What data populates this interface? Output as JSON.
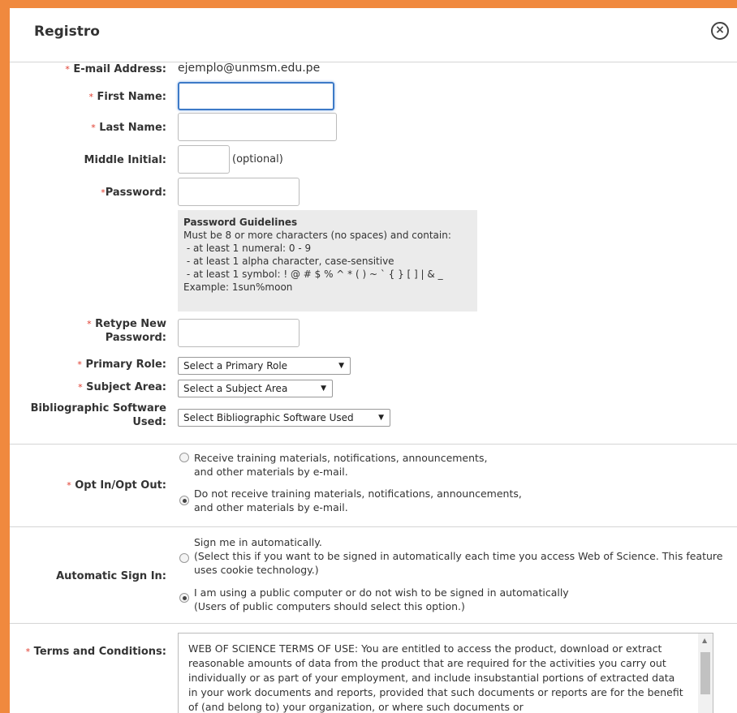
{
  "dialog": {
    "title": "Registro"
  },
  "form": {
    "email": {
      "label": "E-mail Address:",
      "value": "ejemplo@unmsm.edu.pe"
    },
    "first_name": {
      "label": "First Name:",
      "value": ""
    },
    "last_name": {
      "label": "Last Name:",
      "value": ""
    },
    "middle_initial": {
      "label": "Middle Initial:",
      "value": "",
      "hint": "(optional)"
    },
    "password": {
      "label": "Password:",
      "value": ""
    },
    "guidelines": {
      "title": "Password Guidelines",
      "lines": [
        "Must be 8 or more characters (no spaces) and contain:",
        " - at least 1 numeral: 0 - 9",
        " - at least 1 alpha character, case-sensitive",
        " - at least 1 symbol: ! @ # $ % ^ * ( ) ~ ` { } [ ] | & _",
        "Example: 1sun%moon"
      ]
    },
    "retype": {
      "label_line1": "Retype New",
      "label_line2": "Password:",
      "value": ""
    },
    "primary_role": {
      "label": "Primary Role:",
      "selected": "Select a Primary Role"
    },
    "subject_area": {
      "label": "Subject Area:",
      "selected": "Select a Subject Area"
    },
    "biblio": {
      "label_line1": "Bibliographic Software",
      "label_line2": "Used:",
      "selected": "Select Bibliographic Software Used"
    }
  },
  "opt": {
    "label": "Opt In/Opt Out:",
    "options": [
      {
        "line1": "Receive training materials, notifications, announcements,",
        "line2": "and other materials by e-mail.",
        "selected": false
      },
      {
        "line1": "Do not receive training materials, notifications, announcements,",
        "line2": "and other materials by e-mail.",
        "selected": true
      }
    ]
  },
  "signin": {
    "label": "Automatic Sign In:",
    "options": [
      {
        "line1": "Sign me in automatically.",
        "line2": "(Select this if you want to be signed in automatically each time you access Web of Science. This feature",
        "line3": "uses cookie technology.)",
        "selected": false
      },
      {
        "line1": "I am using a public computer or do not wish to be signed in automatically",
        "line2": "(Users of public computers should select this option.)",
        "selected": true
      }
    ]
  },
  "terms": {
    "label": "Terms and Conditions:",
    "text": "WEB OF SCIENCE TERMS OF USE: You are entitled to access the product, download or extract reasonable amounts of data from the product that are required for the activities you carry out individually or as part of your employment, and include insubstantial portions of extracted data in your work documents and reports, provided that such documents or reports are for the benefit of (and belong to) your organization, or where such documents or"
  },
  "colors": {
    "background": "#f0893e",
    "required": "#e03a2c",
    "focus": "#3d7ac7"
  },
  "required_marker": "*"
}
